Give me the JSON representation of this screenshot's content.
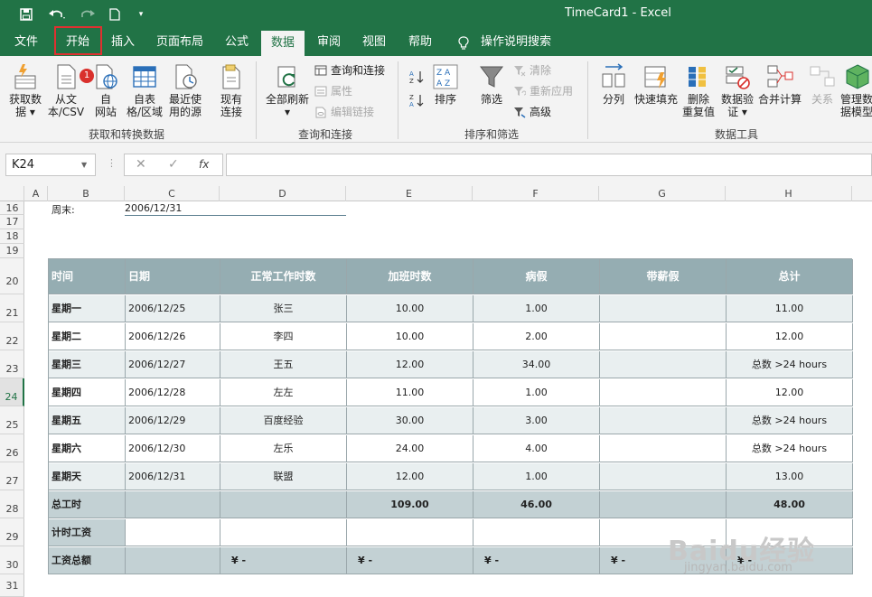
{
  "title_bar": {
    "title": "TimeCard1  -  Excel"
  },
  "tabs": [
    "文件",
    "开始",
    "插入",
    "页面布局",
    "公式",
    "数据",
    "审阅",
    "视图",
    "帮助",
    "操作说明搜索"
  ],
  "active_tab": "数据",
  "highlighted_tab": "开始",
  "ribbon": {
    "groups": {
      "get_transform": {
        "label": "获取和转换数据",
        "buttons": [
          {
            "label": "获取数\n据 ▾",
            "icon": "get-data-icon"
          },
          {
            "label": "从文\n本/CSV",
            "icon": "from-text-icon",
            "badge": "1"
          },
          {
            "label": "自\n网站",
            "icon": "from-web-icon"
          },
          {
            "label": "自表\n格/区域",
            "icon": "from-table-icon"
          },
          {
            "label": "最近使\n用的源",
            "icon": "recent-sources-icon"
          },
          {
            "label": "现有\n连接",
            "icon": "existing-connections-icon"
          }
        ]
      },
      "queries": {
        "label": "查询和连接",
        "refresh": {
          "label": "全部刷新\n▾",
          "icon": "refresh-all-icon"
        },
        "small": [
          {
            "label": "查询和连接",
            "enabled": true
          },
          {
            "label": "属性",
            "enabled": false
          },
          {
            "label": "编辑链接",
            "enabled": false
          }
        ]
      },
      "sort_filter": {
        "label": "排序和筛选",
        "sort": "排序",
        "filter": "筛选",
        "small": [
          {
            "label": "清除",
            "enabled": false
          },
          {
            "label": "重新应用",
            "enabled": false
          },
          {
            "label": "高级",
            "enabled": true
          }
        ]
      },
      "data_tools": {
        "label": "数据工具",
        "buttons": [
          {
            "label": "分列",
            "icon": "text-to-columns-icon"
          },
          {
            "label": "快速填充",
            "icon": "flash-fill-icon"
          },
          {
            "label": "删除\n重复值",
            "icon": "remove-duplicates-icon"
          },
          {
            "label": "数据验\n证 ▾",
            "icon": "data-validation-icon"
          },
          {
            "label": "合并计算",
            "icon": "consolidate-icon"
          },
          {
            "label": "关系",
            "icon": "relationships-icon"
          },
          {
            "label": "管理数\n据模型",
            "icon": "data-model-icon"
          }
        ]
      }
    }
  },
  "formula_bar": {
    "name_box": "K24",
    "cancel": "✕",
    "enter": "✓",
    "fx": "fx",
    "formula": ""
  },
  "columns": [
    "A",
    "B",
    "C",
    "D",
    "E",
    "F",
    "G",
    "H"
  ],
  "rows": [
    "16",
    "17",
    "18",
    "19",
    "20",
    "21",
    "22",
    "23",
    "24",
    "25",
    "26",
    "27",
    "28",
    "29",
    "30",
    "31"
  ],
  "selected_row": "24",
  "week_end": {
    "label": "周末:",
    "value": "2006/12/31"
  },
  "table": {
    "headers": [
      "时间",
      "日期",
      "正常工作时数",
      "加班时数",
      "病假",
      "带薪假",
      "总计"
    ],
    "rows": [
      [
        "星期一",
        "2006/12/25",
        "张三",
        "10.00",
        "1.00",
        "",
        "11.00"
      ],
      [
        "星期二",
        "2006/12/26",
        "李四",
        "10.00",
        "2.00",
        "",
        "12.00"
      ],
      [
        "星期三",
        "2006/12/27",
        "王五",
        "12.00",
        "34.00",
        "",
        "总数 >24 hours"
      ],
      [
        "星期四",
        "2006/12/28",
        "左左",
        "11.00",
        "1.00",
        "",
        "12.00"
      ],
      [
        "星期五",
        "2006/12/29",
        "百度经验",
        "30.00",
        "3.00",
        "",
        "总数 >24 hours"
      ],
      [
        "星期六",
        "2006/12/30",
        "左乐",
        "24.00",
        "4.00",
        "",
        "总数 >24 hours"
      ],
      [
        "星期天",
        "2006/12/31",
        "联盟",
        "12.00",
        "1.00",
        "",
        "13.00"
      ]
    ],
    "total_row": [
      "总工时",
      "",
      "",
      "109.00",
      "46.00",
      "",
      "48.00"
    ],
    "hourly_row": [
      "计时工资",
      "",
      "",
      "",
      "",
      "",
      ""
    ],
    "pay_row": [
      "工资总额",
      "",
      "¥            -",
      "¥            -",
      "¥            -",
      "¥            -",
      "¥            -"
    ]
  },
  "watermark": {
    "brand": "Baidu经验",
    "url": "jingyan.baidu.com"
  }
}
